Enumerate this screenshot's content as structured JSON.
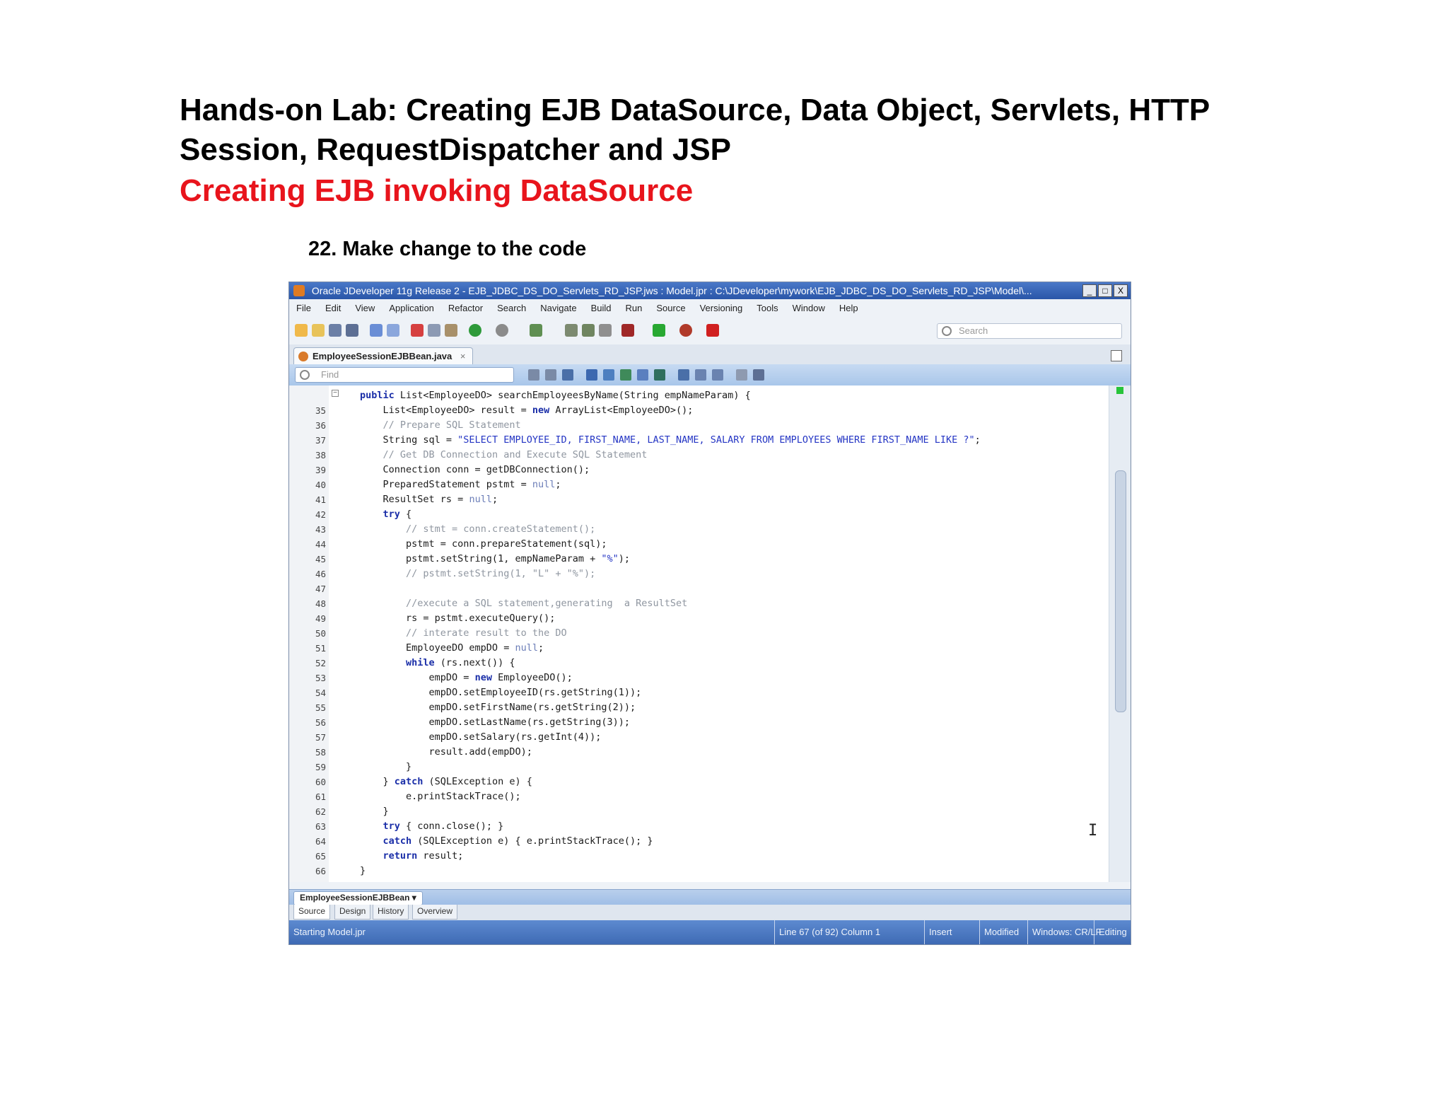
{
  "slide": {
    "title": "Hands-on Lab: Creating EJB DataSource, Data Object, Servlets, HTTP Session, RequestDispatcher and JSP",
    "subtitle": "Creating EJB invoking DataSource",
    "step": "22. Make change to the code"
  },
  "ide": {
    "window_title": "Oracle JDeveloper 11g Release 2 - EJB_JDBC_DS_DO_Servlets_RD_JSP.jws : Model.jpr : C:\\JDeveloper\\mywork\\EJB_JDBC_DS_DO_Servlets_RD_JSP\\Model\\...",
    "window_buttons": [
      "_",
      "□",
      "X"
    ],
    "menu": [
      "File",
      "Edit",
      "View",
      "Application",
      "Refactor",
      "Search",
      "Navigate",
      "Build",
      "Run",
      "Source",
      "Versioning",
      "Tools",
      "Window",
      "Help"
    ],
    "search_placeholder": "Search",
    "file_tab": "EmployeeSessionEJBBean.java",
    "tab_close": "×",
    "find_placeholder": "Find",
    "breadcrumb": "EmployeeSessionEJBBean ▾",
    "editor_tabs": [
      "Source",
      "Design",
      "History",
      "Overview"
    ],
    "status": {
      "left": "Starting Model.jpr",
      "line": "Line 67 (of 92) Column 1",
      "mode": "Insert",
      "modified": "Modified",
      "eol": "Windows: CR/LF",
      "editing": "Editing"
    },
    "caret_glyph": "I"
  },
  "code_lines": [
    {
      "num": "",
      "text": "public List<EmployeeDO> searchEmployeesByName(String empNameParam) {"
    },
    {
      "num": "35",
      "text": "    List<EmployeeDO> result = new ArrayList<EmployeeDO>();"
    },
    {
      "num": "36",
      "text": "    // Prepare SQL Statement"
    },
    {
      "num": "37",
      "text": "    String sql = \"SELECT EMPLOYEE_ID, FIRST_NAME, LAST_NAME, SALARY FROM EMPLOYEES WHERE FIRST_NAME LIKE ?\";"
    },
    {
      "num": "38",
      "text": "    // Get DB Connection and Execute SQL Statement"
    },
    {
      "num": "39",
      "text": "    Connection conn = getDBConnection();"
    },
    {
      "num": "40",
      "text": "    PreparedStatement pstmt = null;"
    },
    {
      "num": "41",
      "text": "    ResultSet rs = null;"
    },
    {
      "num": "42",
      "text": "    try {"
    },
    {
      "num": "43",
      "text": "        // stmt = conn.createStatement();"
    },
    {
      "num": "44",
      "text": "        pstmt = conn.prepareStatement(sql);"
    },
    {
      "num": "45",
      "text": "        pstmt.setString(1, empNameParam + \"%\");"
    },
    {
      "num": "46",
      "text": "        // pstmt.setString(1, \"L\" + \"%\");"
    },
    {
      "num": "47",
      "text": ""
    },
    {
      "num": "48",
      "text": "        //execute a SQL statement,generating  a ResultSet"
    },
    {
      "num": "49",
      "text": "        rs = pstmt.executeQuery();"
    },
    {
      "num": "50",
      "text": "        // interate result to the DO"
    },
    {
      "num": "51",
      "text": "        EmployeeDO empDO = null;"
    },
    {
      "num": "52",
      "text": "        while (rs.next()) {"
    },
    {
      "num": "53",
      "text": "            empDO = new EmployeeDO();"
    },
    {
      "num": "54",
      "text": "            empDO.setEmployeeID(rs.getString(1));"
    },
    {
      "num": "55",
      "text": "            empDO.setFirstName(rs.getString(2));"
    },
    {
      "num": "56",
      "text": "            empDO.setLastName(rs.getString(3));"
    },
    {
      "num": "57",
      "text": "            empDO.setSalary(rs.getInt(4));"
    },
    {
      "num": "58",
      "text": "            result.add(empDO);"
    },
    {
      "num": "59",
      "text": "        }"
    },
    {
      "num": "60",
      "text": "    } catch (SQLException e) {"
    },
    {
      "num": "61",
      "text": "        e.printStackTrace();"
    },
    {
      "num": "62",
      "text": "    }"
    },
    {
      "num": "63",
      "text": "    try { conn.close(); }"
    },
    {
      "num": "64",
      "text": "    catch (SQLException e) { e.printStackTrace(); }"
    },
    {
      "num": "65",
      "text": "    return result;"
    },
    {
      "num": "66",
      "text": "}"
    }
  ]
}
